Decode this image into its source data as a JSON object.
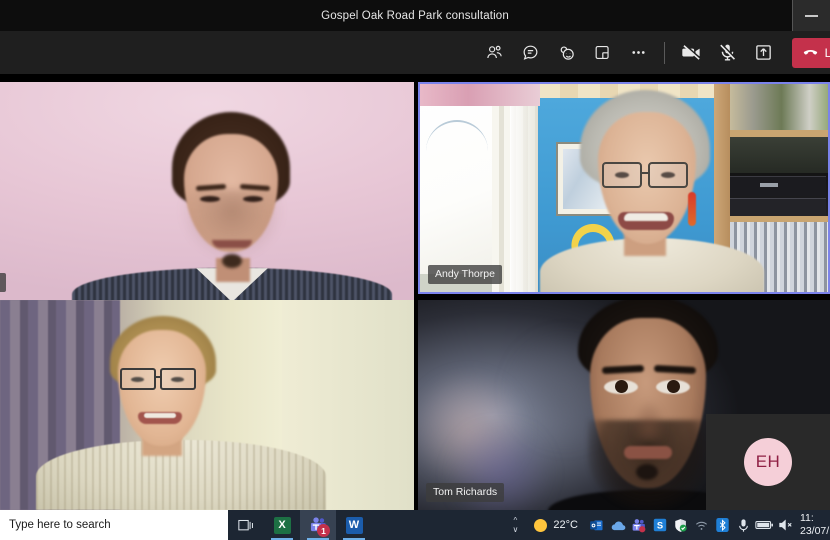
{
  "window": {
    "title": "Gospel Oak Road Park consultation",
    "minimize_label": "Minimize"
  },
  "toolbar": {
    "items": [
      {
        "name": "people-icon",
        "label": "Show participants"
      },
      {
        "name": "chat-icon",
        "label": "Show conversation"
      },
      {
        "name": "reactions-icon",
        "label": "Reactions"
      },
      {
        "name": "breakout-rooms-icon",
        "label": "Rooms"
      },
      {
        "name": "more-options-icon",
        "label": "More actions"
      },
      {
        "name": "camera-off-icon",
        "label": "Turn camera on"
      },
      {
        "name": "mic-off-icon",
        "label": "Unmute"
      },
      {
        "name": "share-icon",
        "label": "Share content"
      }
    ],
    "leave_label": "Le",
    "leave_full_label": "Leave",
    "leave_color": "#c4314b"
  },
  "meeting": {
    "active_speaker_border_color": "#7b83eb",
    "tiles": [
      {
        "id": "tile1",
        "name": "n",
        "position": "top-left",
        "active": false,
        "video_on": true
      },
      {
        "id": "tile2",
        "name": "Andy Thorpe",
        "position": "top-right",
        "active": true,
        "video_on": true
      },
      {
        "id": "tile3",
        "name": "",
        "position": "bottom-left",
        "active": false,
        "video_on": true
      },
      {
        "id": "tile4",
        "name": "Tom Richards",
        "position": "bottom-right",
        "active": false,
        "video_on": true
      }
    ],
    "pip": {
      "initials": "EH",
      "avatar_bg": "#f5cfd8",
      "avatar_fg": "#8f2044",
      "video_on": false
    }
  },
  "taskbar": {
    "search_placeholder": "Type here to search",
    "buttons": [
      {
        "name": "task-view-icon",
        "label": "Task View"
      },
      {
        "name": "excel-icon",
        "label": "Excel",
        "badge": ""
      },
      {
        "name": "teams-icon",
        "label": "Microsoft Teams",
        "badge": "1"
      },
      {
        "name": "word-icon",
        "label": "Word",
        "badge": ""
      }
    ],
    "tray": {
      "show_hidden_label": "Show hidden icons",
      "weather": "22°C",
      "weather_icon": "sun-icon",
      "icons": [
        {
          "name": "outlook-tray-icon",
          "label": "Outlook"
        },
        {
          "name": "onedrive-tray-icon",
          "label": "OneDrive"
        },
        {
          "name": "teams-tray-icon",
          "label": "Microsoft Teams"
        },
        {
          "name": "sophos-tray-icon",
          "label": "S"
        },
        {
          "name": "security-tray-icon",
          "label": "Windows Security"
        },
        {
          "name": "wifi-tray-icon",
          "label": "Network"
        },
        {
          "name": "bluetooth-tray-icon",
          "label": "Bluetooth"
        },
        {
          "name": "microphone-tray-icon",
          "label": "Microphone in use"
        },
        {
          "name": "battery-tray-icon",
          "label": "Battery"
        },
        {
          "name": "volume-muted-icon",
          "label": "Volume muted"
        }
      ],
      "clock_time": "11:",
      "clock_date": "23/07/"
    }
  }
}
